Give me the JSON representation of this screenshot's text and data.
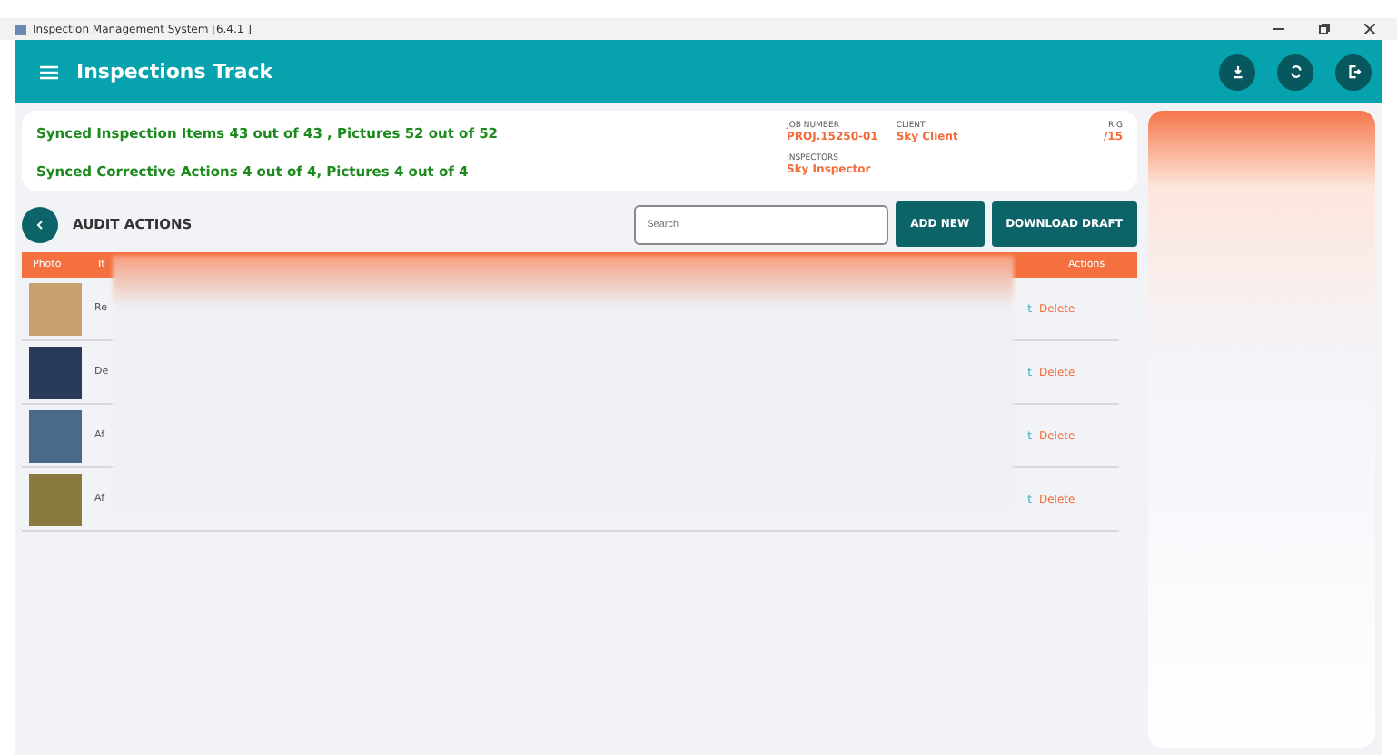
{
  "window": {
    "title": "Inspection Management System [6.4.1 ]"
  },
  "header": {
    "title": "Inspections Track"
  },
  "sync": {
    "lines": [
      "Synced Inspection Items 43 out of 43 , Pictures 52 out of 52",
      "Synced Corrective Actions 4 out of 4, Pictures 4 out of 4"
    ]
  },
  "job": {
    "fields": [
      {
        "label": "JOB NUMBER",
        "value": "PROJ.15250-01"
      },
      {
        "label": "CLIENT",
        "value": "Sky Client"
      },
      {
        "label": "RIG",
        "value": "/15"
      },
      {
        "label": "INSPECTORS",
        "value": "Sky Inspector"
      }
    ]
  },
  "section": {
    "title": "AUDIT ACTIONS"
  },
  "search": {
    "placeholder": "Search"
  },
  "buttons": [
    "ADD NEW",
    "DOWNLOAD DRAFT"
  ],
  "table": {
    "columns": [
      "Photo",
      "It",
      "Actions"
    ],
    "rows": [
      {
        "color": "#c8a070",
        "text": "Re",
        "edit": "t",
        "delete": "Delete"
      },
      {
        "color": "#2a3a5a",
        "text": "De",
        "edit": "t",
        "delete": "Delete"
      },
      {
        "color": "#4a6a8a",
        "text": "Af",
        "edit": "t",
        "delete": "Delete"
      },
      {
        "color": "#8a7a40",
        "text": "Af",
        "edit": "t",
        "delete": "Delete"
      }
    ]
  }
}
